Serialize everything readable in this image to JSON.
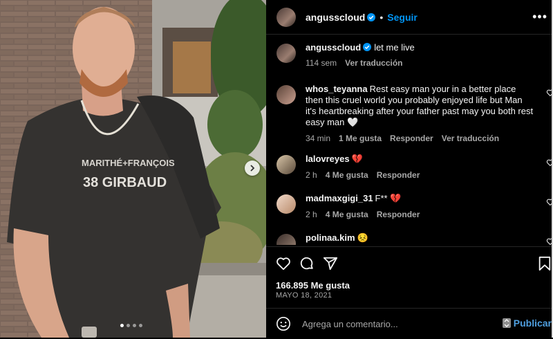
{
  "post": {
    "author": "angusscloud",
    "follow_label": "Seguir",
    "separator": "•",
    "more_icon": "more-horizontal-icon",
    "caption_user": "angusscloud",
    "caption_text": "let me live",
    "caption_age": "114 sem",
    "caption_translate": "Ver traducción",
    "likes": "166.895 Me gusta",
    "date": "MAYO 18, 2021"
  },
  "comments": [
    {
      "user": "whos_teyanna",
      "text": "Rest easy man your in a better place then this cruel world you probably enjoyed life but Man it's heartbreaking after your father past may you both rest easy man 🤍",
      "age": "34 min",
      "likes": "1 Me gusta",
      "reply": "Responder",
      "translate": "Ver traducción"
    },
    {
      "user": "lalovreyes",
      "text": "💔",
      "age": "2 h",
      "likes": "4 Me gusta",
      "reply": "Responder"
    },
    {
      "user": "madmaxgigi_31",
      "text": "F** 💔",
      "age": "2 h",
      "likes": "4 Me gusta",
      "reply": "Responder"
    },
    {
      "user": "polinaa.kim",
      "text": "😣"
    }
  ],
  "composer": {
    "placeholder": "Agrega un comentario...",
    "publish_label": "Publicar"
  },
  "photo": {
    "shirt_text_line1": "MARITHÉ+FRANÇOIS",
    "shirt_text_line2": "38 GIRBAUD",
    "carousel_total": 4,
    "carousel_active": 1
  },
  "colors": {
    "accent": "#0095f6",
    "verified": "#0095f6",
    "broken_heart": "#e0245e"
  }
}
